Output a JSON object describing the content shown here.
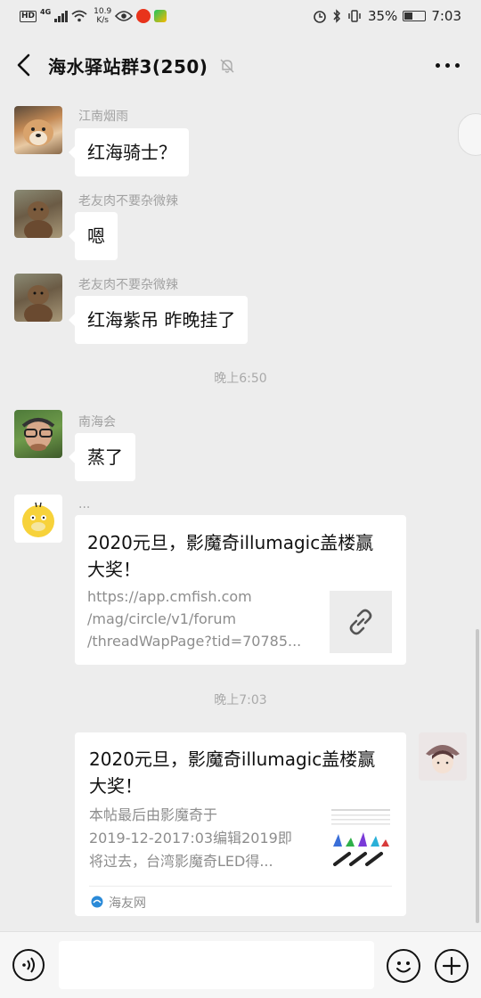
{
  "status_bar": {
    "hd": "HD",
    "network": "4G",
    "speed_value": "10.9",
    "speed_unit": "K/s",
    "battery": "35%",
    "time": "7:03"
  },
  "header": {
    "title": "海水驿站群3(250)"
  },
  "messages": [
    {
      "sender": "江南烟雨",
      "text": "红海骑士？"
    },
    {
      "sender": "老友肉不要杂微辣",
      "text": "嗯"
    },
    {
      "sender": "老友肉不要杂微辣",
      "text": "红海紫吊 昨晚挂了"
    },
    {
      "sender": "南海会",
      "text": "蒸了"
    }
  ],
  "timestamps": [
    "晚上6:50",
    "晚上7:03"
  ],
  "link_message": {
    "sender": "...",
    "title": "2020元旦，影魔奇illumagic盖楼赢大奖！",
    "url_lines": [
      "https://app.cmfish.com",
      "/mag/circle/v1/forum",
      "/threadWapPage?tid=70785..."
    ]
  },
  "share_card": {
    "title": "2020元旦，影魔奇illumagic盖楼赢大奖！",
    "desc_lines": [
      "本帖最后由影魔奇于",
      "2019-12-2017:03编辑2019即",
      "将过去，台湾影魔奇LED得..."
    ],
    "source": "海友网"
  },
  "input": {
    "placeholder": ""
  },
  "icons": {
    "back": "back-arrow-icon",
    "mute": "mute-bell-icon",
    "more": "more-icon",
    "voice": "voice-icon",
    "emoji": "emoji-icon",
    "plus": "plus-icon",
    "link": "link-icon"
  },
  "colors": {
    "background": "#ededed",
    "bubble": "#ffffff",
    "nickname": "#a2a2a2"
  }
}
